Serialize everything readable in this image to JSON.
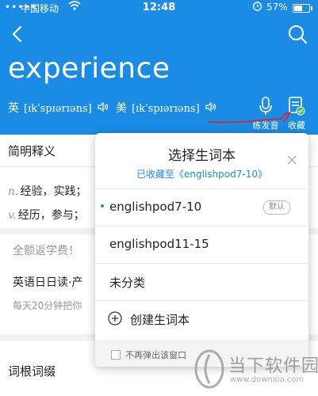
{
  "status_bar": {
    "carrier": "中国移动",
    "time": "12:48",
    "battery_percent": "57%"
  },
  "word": {
    "headword": "experience",
    "uk_label": "英",
    "uk_ipa": "[ɪkˈspɪərɪəns]",
    "us_label": "美",
    "us_ipa": "[ɪkˈspɪərɪəns]"
  },
  "toolbar": {
    "practice_label": "练发音",
    "favorite_label": "收藏"
  },
  "sections": {
    "brief_definition": "简明释义",
    "root_affix": "词根词缀"
  },
  "definitions": [
    {
      "pos": "n.",
      "text": "经验，实践；"
    },
    {
      "pos": "v.",
      "text": "经历，参与；"
    }
  ],
  "ad": {
    "title": "全额返学费！",
    "subtitle": "英语日日读·产",
    "desc": "每天20分钟把你"
  },
  "popup": {
    "title": "选择生词本",
    "subtitle": "已收藏至《englishpod7-10》",
    "wordbooks": [
      {
        "name": "englishpod7-10",
        "badge": "默认"
      },
      {
        "name": "englishpod11-15"
      },
      {
        "name": "未分类"
      }
    ],
    "create_label": "创建生词本",
    "dont_show_label": "不再弹出该窗口"
  },
  "watermark": {
    "brand": "当下软件园",
    "url": "www.downxia.com"
  },
  "colors": {
    "header_bg": "#1a8ce6",
    "accent": "#1a8ce6",
    "annotation_red": "#d9262b",
    "badge_green": "#3cc35a"
  }
}
